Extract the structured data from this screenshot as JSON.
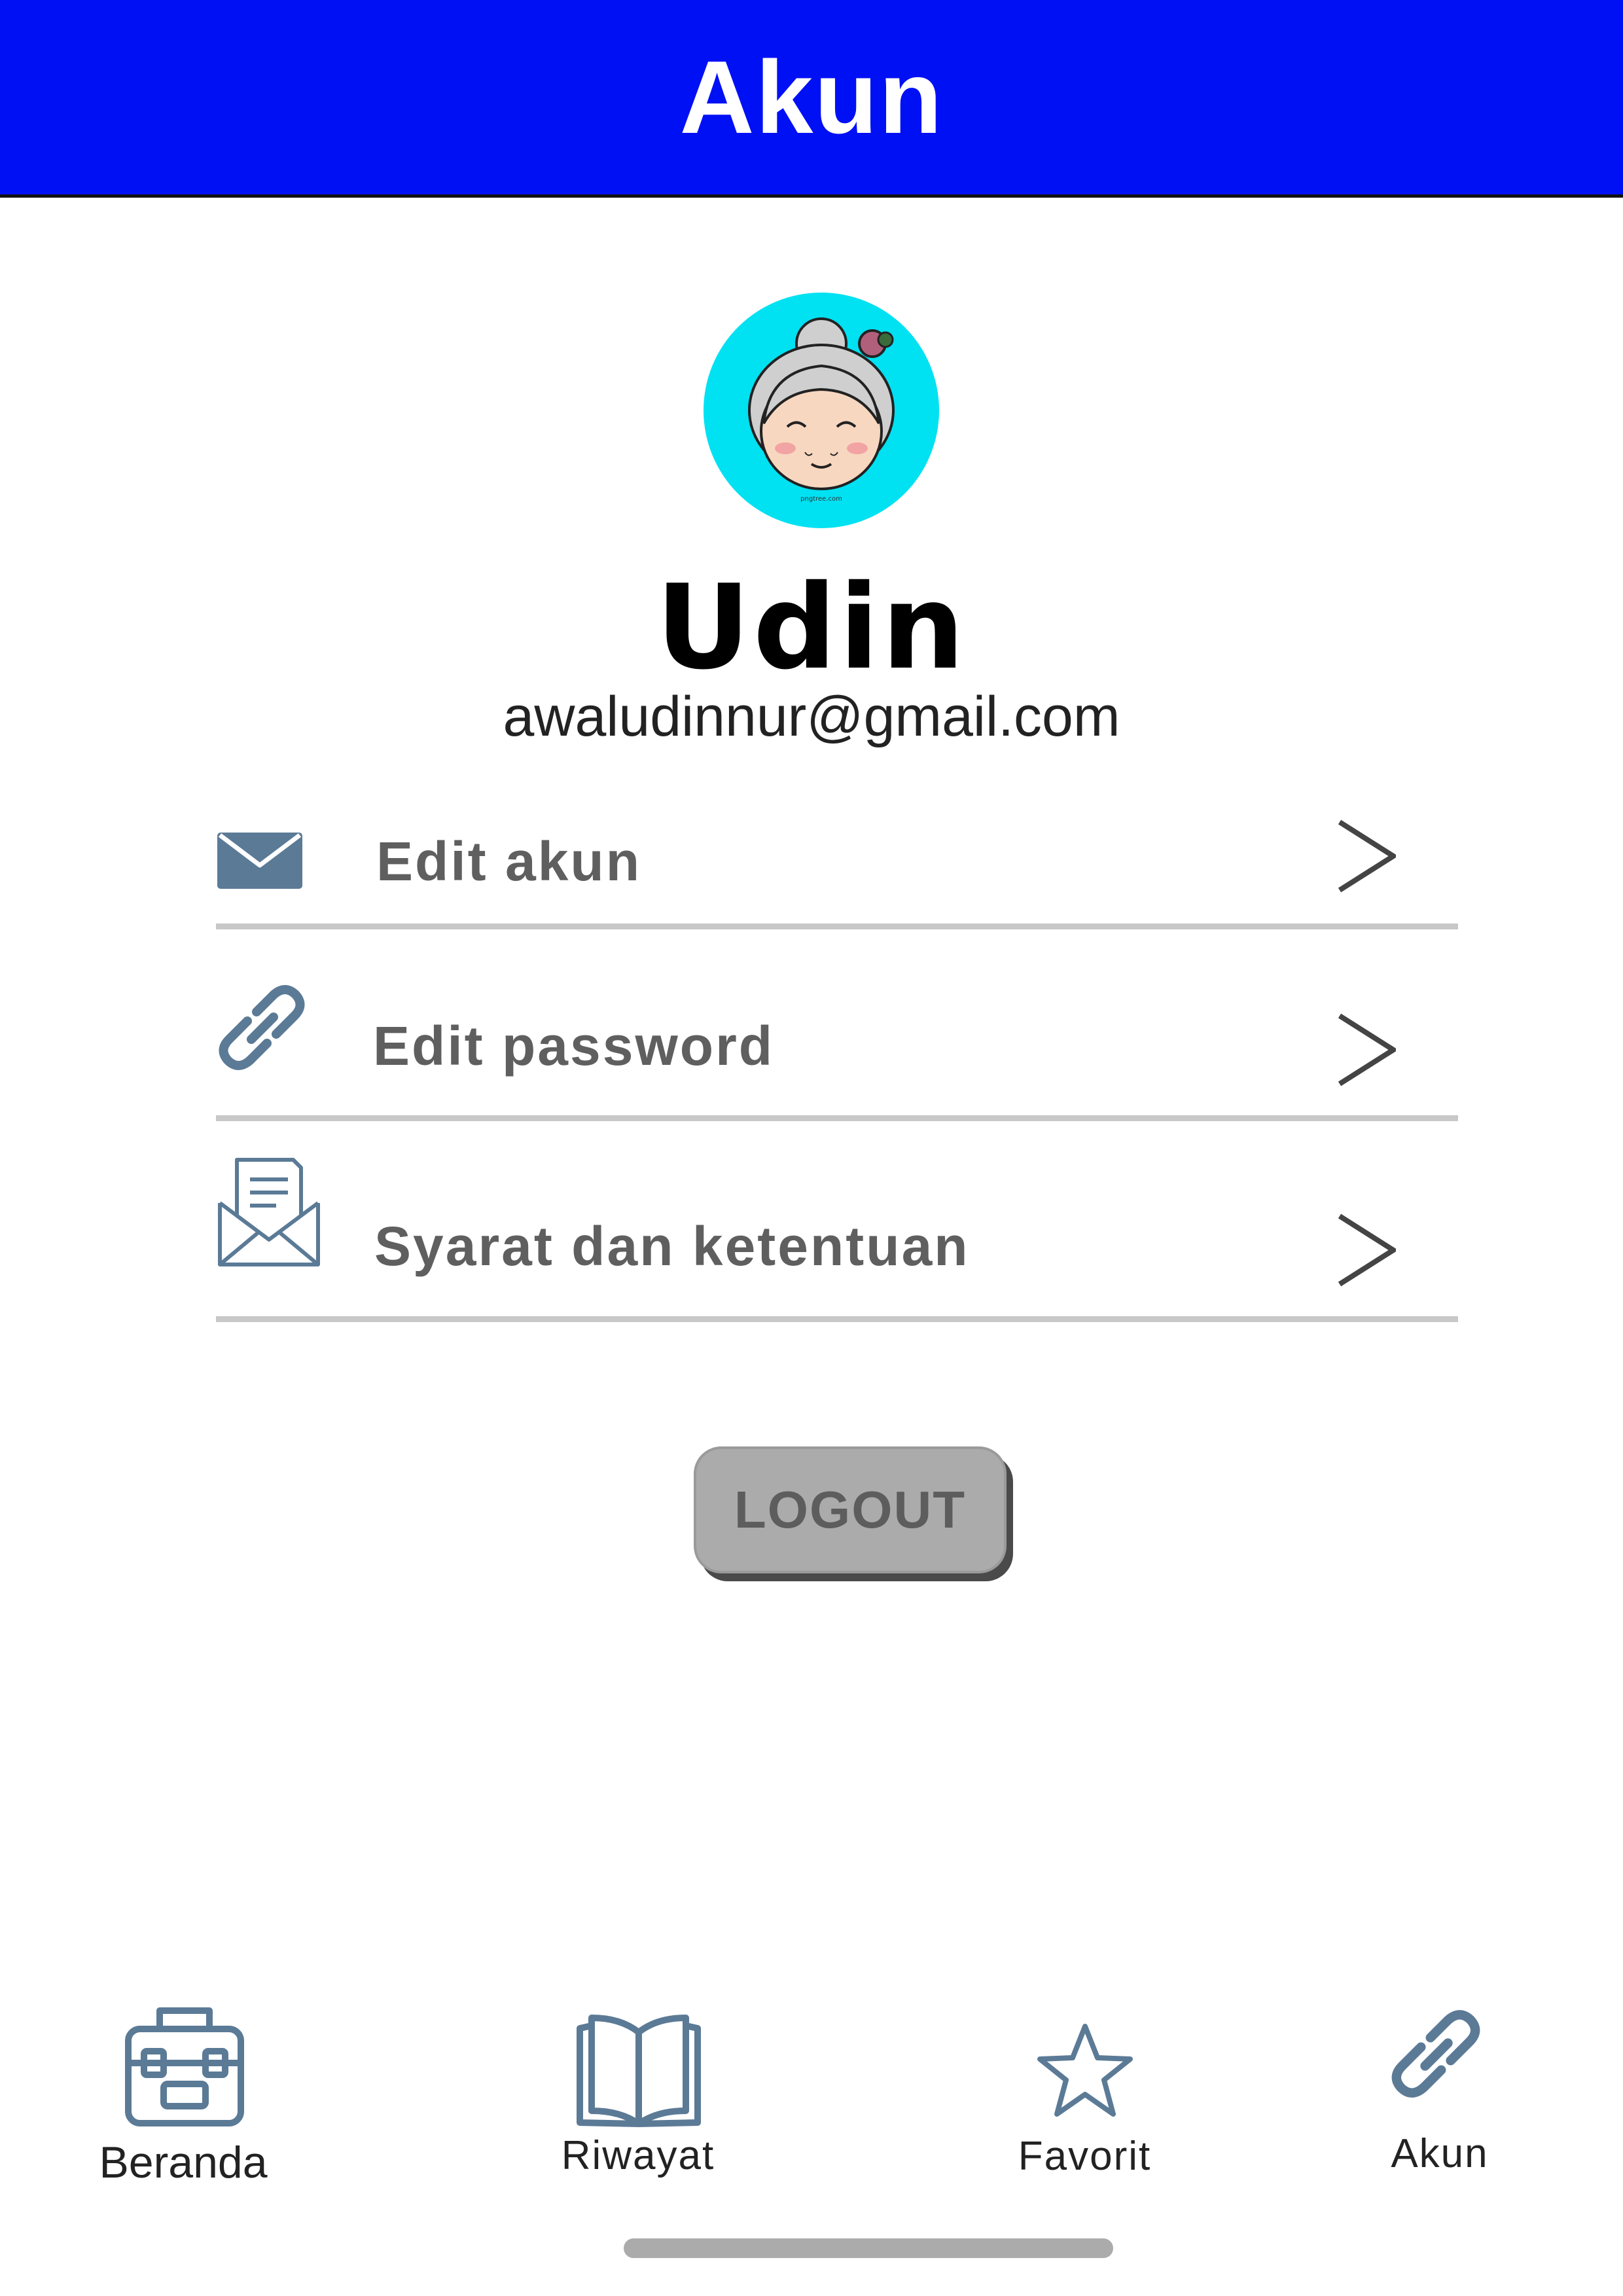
{
  "header": {
    "title": "Akun"
  },
  "profile": {
    "name": "Udin",
    "email": "awaludinnur@gmail.com",
    "avatar_watermark": "pngtree.com"
  },
  "menu": [
    {
      "label": "Edit akun",
      "icon": "envelope-icon",
      "chevron": ">"
    },
    {
      "label": "Edit password",
      "icon": "link-icon",
      "chevron": ">"
    },
    {
      "label": "Syarat dan ketentuan",
      "icon": "open-letter-icon",
      "chevron": ">"
    }
  ],
  "logout": {
    "label": "LOGOUT"
  },
  "bottom_nav": [
    {
      "label": "Beranda",
      "icon": "briefcase-icon"
    },
    {
      "label": "Riwayat",
      "icon": "book-icon"
    },
    {
      "label": "Favorit",
      "icon": "star-icon"
    },
    {
      "label": "Akun",
      "icon": "link-icon",
      "active": true
    }
  ],
  "colors": {
    "header_bg": "#0010f5",
    "avatar_bg": "#00e1f2",
    "icon": "#5b7a96",
    "logout_bg": "#ababab"
  }
}
